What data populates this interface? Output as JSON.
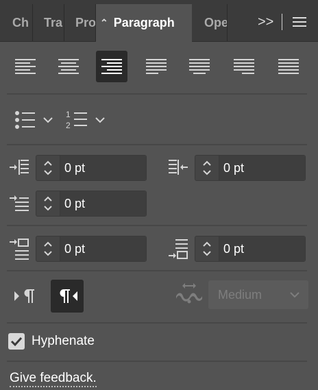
{
  "tabs": [
    {
      "label": "Ch"
    },
    {
      "label": "Tra"
    },
    {
      "label": "Pro"
    },
    {
      "label": "Paragraph"
    },
    {
      "label": "Ope"
    }
  ],
  "tab_controls": {
    "expand_icon": ">>",
    "menu_icon": "hamburger-icon"
  },
  "alignment": {
    "options": [
      "align-left",
      "align-center",
      "align-right",
      "justify-last-left",
      "justify-last-center",
      "justify-last-right",
      "justify-all"
    ],
    "selected": "align-right"
  },
  "indents": {
    "left_indent": {
      "value": "0 pt"
    },
    "right_indent": {
      "value": "0 pt"
    },
    "first_line_indent": {
      "value": "0 pt"
    },
    "space_before": {
      "value": "0 pt"
    },
    "space_after": {
      "value": "0 pt"
    }
  },
  "direction": {
    "selected": "right-to-left"
  },
  "kashida": {
    "value": "Medium",
    "enabled": false
  },
  "hyphenate": {
    "label": "Hyphenate",
    "checked": true
  },
  "feedback": {
    "label": "Give feedback."
  }
}
